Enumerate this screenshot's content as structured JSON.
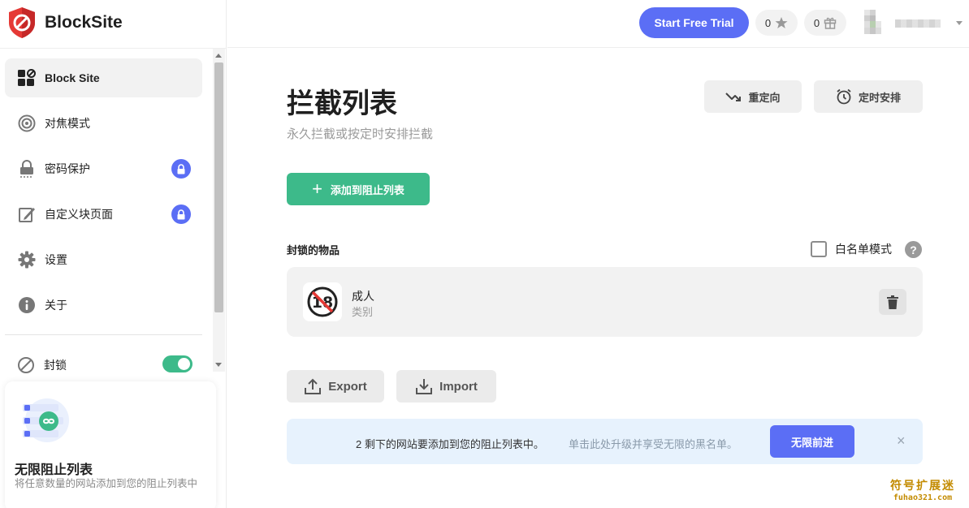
{
  "app": {
    "name": "BlockSite"
  },
  "sidebar": {
    "items": [
      {
        "label": "Block Site",
        "icon": "block-site-icon",
        "active": true,
        "locked": false
      },
      {
        "label": "对焦模式",
        "icon": "focus-icon",
        "active": false,
        "locked": false
      },
      {
        "label": "密码保护",
        "icon": "password-icon",
        "active": false,
        "locked": true
      },
      {
        "label": "自定义块页面",
        "icon": "custom-page-icon",
        "active": false,
        "locked": true
      },
      {
        "label": "设置",
        "icon": "gear-icon",
        "active": false,
        "locked": false
      },
      {
        "label": "关于",
        "icon": "info-icon",
        "active": false,
        "locked": false
      }
    ],
    "block_toggle": {
      "label": "封锁",
      "on": true
    },
    "promo": {
      "title": "无限阻止列表",
      "description": "将任意数量的网站添加到您的阻止列表中"
    }
  },
  "header": {
    "trial_button": "Start Free Trial",
    "stars_count": "0",
    "gifts_count": "0"
  },
  "main": {
    "title": "拦截列表",
    "subtitle": "永久拦截或按定时安排拦截",
    "redirect_button": "重定向",
    "schedule_button": "定时安排",
    "add_button": "添加到阻止列表",
    "section_title": "封锁的物品",
    "whitelist_label": "白名单模式",
    "help_icon": "?",
    "blocked_items": [
      {
        "name": "成人",
        "type": "类别",
        "icon": "adult-18-icon"
      }
    ],
    "export_button": "Export",
    "import_button": "Import",
    "notice": {
      "message": "2 剩下的网站要添加到您的阻止列表中。",
      "hint": "单击此处升级并享受无限的黑名单。",
      "button": "无限前进",
      "close": "×"
    }
  },
  "watermark": {
    "line1": "符号扩展迷",
    "line2": "fuhao321.com"
  },
  "colors": {
    "accent": "#5b6ef5",
    "green": "#3dba8a",
    "brand_red": "#e53935",
    "notice_bg": "#e7f2fd"
  }
}
